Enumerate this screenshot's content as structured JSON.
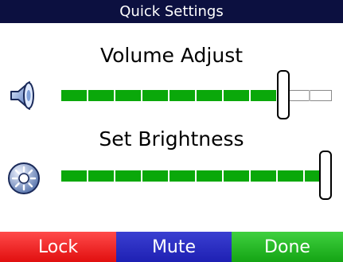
{
  "header": {
    "title": "Quick Settings"
  },
  "volume": {
    "label": "Volume Adjust",
    "icon": "speaker-icon",
    "level": 0.82
  },
  "brightness": {
    "label": "Set Brightness",
    "icon": "sun-icon",
    "level": 1.0
  },
  "buttons": {
    "lock": "Lock",
    "mute": "Mute",
    "done": "Done"
  },
  "colors": {
    "title_bar": "#0c1040",
    "slider_fill": "#0aa80a",
    "lock": "#e10f0f",
    "mute": "#1e20b3",
    "done": "#14a414"
  }
}
